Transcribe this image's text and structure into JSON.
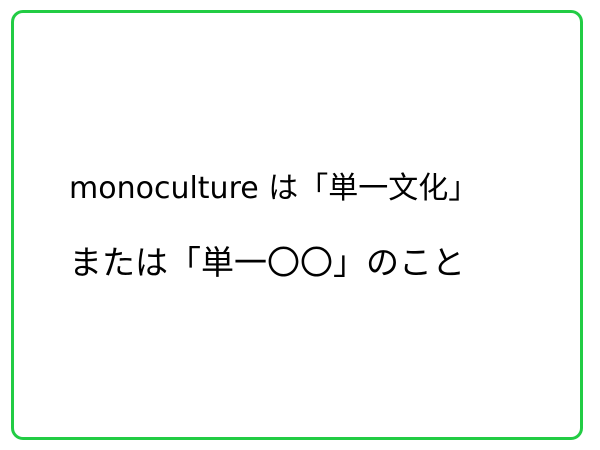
{
  "card": {
    "border_color": "#22cc44",
    "background_color": "#ffffff",
    "lines": [
      "monoculture は「単一文化」",
      "または「単一〇〇」のこと"
    ]
  }
}
